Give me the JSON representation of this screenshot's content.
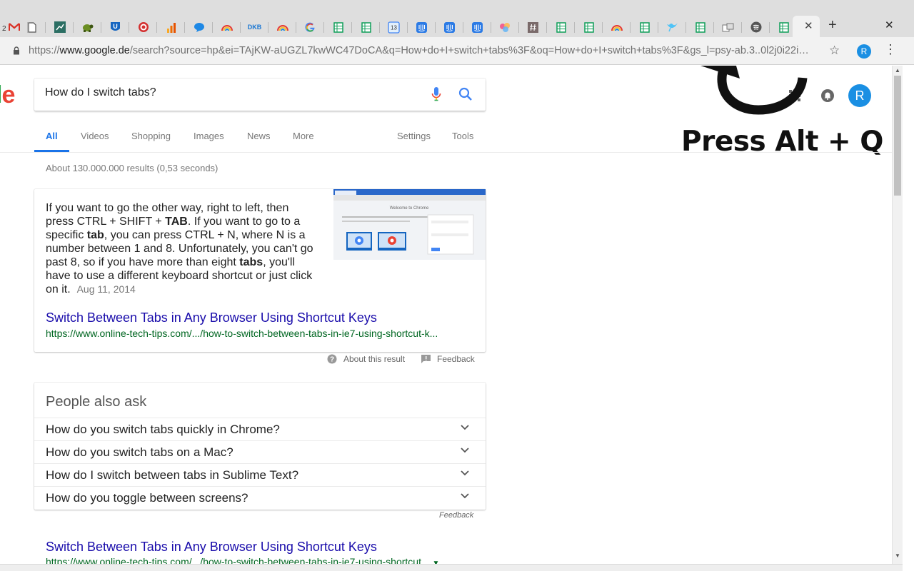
{
  "browser": {
    "mail_count": "2",
    "url_host_prefix": "https://",
    "url_host": "www.google.de",
    "url_path": "/search?source=hp&ei=TAjKW-aUGZL7kwWC47DoCA&q=How+do+I+switch+tabs%3F&oq=How+do+I+switch+tabs%3F&gs_l=psy-ab.3..0l2j0i22i…",
    "calendar_day": "13",
    "tab_badge_text": "DKB",
    "extension_letter": "R",
    "new_tab_glyph": "+",
    "close_glyph": "✕"
  },
  "google": {
    "search_query": "How do I switch tabs?",
    "avatar_letter": "R",
    "nav_tabs": [
      "All",
      "Videos",
      "Shopping",
      "Images",
      "News",
      "More"
    ],
    "nav_tools": [
      "Settings",
      "Tools"
    ],
    "result_stats": "About 130.000.000 results (0,53 seconds)",
    "featured_snippet": {
      "date": "Aug 11, 2014",
      "link_title": "Switch Between Tabs in Any Browser Using Shortcut Keys",
      "link_url": "https://www.online-tech-tips.com/.../how-to-switch-between-tabs-in-ie7-using-shortcut-k...",
      "thumbnail_title": "Welcome to Chrome"
    },
    "about_result": "About this result",
    "feedback": "Feedback",
    "people_also_ask": {
      "title": "People also ask",
      "questions": [
        "How do you switch tabs quickly in Chrome?",
        "How do you switch tabs on a Mac?",
        "How do I switch between tabs in Sublime Text?",
        "How do you toggle between screens?"
      ],
      "feedback": "Feedback"
    },
    "second_result": {
      "title": "Switch Between Tabs in Any Browser Using Shortcut Keys",
      "url": "https://www.online-tech-tips.com/.../how-to-switch-between-tabs-in-ie7-using-shortcut..."
    }
  },
  "overlay": {
    "hint": "Press Alt + Q"
  },
  "colors": {
    "accent_blue": "#1a73e8",
    "link": "#1a0dab",
    "url_green": "#006621",
    "sheets_green": "#0f9d58"
  }
}
